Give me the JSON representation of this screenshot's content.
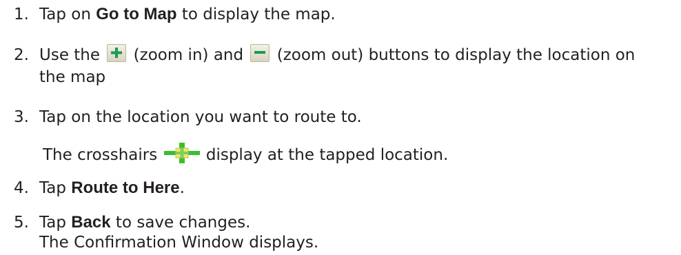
{
  "steps": [
    {
      "number": "1.",
      "prefix": "Tap on ",
      "bold": "Go to Map",
      "suffix": " to display the map."
    },
    {
      "number": "2.",
      "part1": "Use the",
      "zoom_in_text": "(zoom in) and",
      "zoom_out_text": "(zoom out) buttons to display the location on",
      "line2": "the map"
    },
    {
      "number": "3.",
      "text": "Tap on the location you want to route to.",
      "note_prefix": "The crosshairs",
      "note_suffix": "display at the tapped location."
    },
    {
      "number": "4.",
      "prefix": "Tap ",
      "bold": "Route to Here",
      "suffix": "."
    },
    {
      "number": "5.",
      "prefix": "Tap ",
      "bold": "Back",
      "suffix": " to save changes.",
      "line2": "The Confirmation Window displays."
    }
  ],
  "icons": {
    "zoom_in": "plus-icon",
    "zoom_out": "minus-icon",
    "crosshairs": "crosshairs-icon"
  },
  "colors": {
    "text": "#231f20",
    "crosshair_green": "#3bbf2e",
    "crosshair_yellow": "#f0e66b",
    "zoom_button_bg": "#e6e3cf",
    "zoom_symbol": "#1a9a55"
  }
}
